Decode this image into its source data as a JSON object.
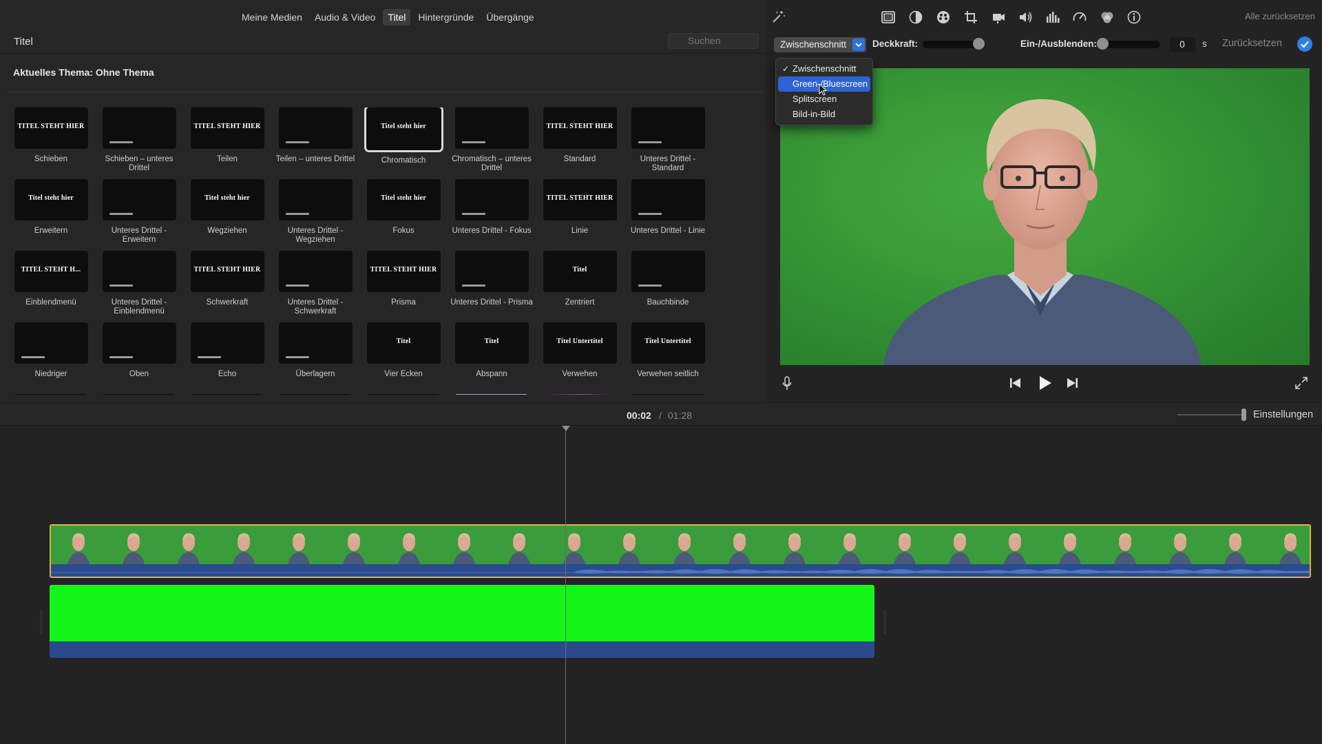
{
  "browser": {
    "tabs": [
      {
        "label": "Meine Medien",
        "active": false
      },
      {
        "label": "Audio & Video",
        "active": false
      },
      {
        "label": "Titel",
        "active": true
      },
      {
        "label": "Hintergründe",
        "active": false
      },
      {
        "label": "Übergänge",
        "active": false
      }
    ],
    "section_title": "Titel",
    "search_placeholder": "Suchen",
    "theme_label": "Aktuelles Thema: Ohne Thema",
    "titles": [
      {
        "label": "Schieben",
        "thumb": "TITEL STEHT HIER"
      },
      {
        "label": "Schieben – unteres Drittel",
        "thumb": ""
      },
      {
        "label": "Teilen",
        "thumb": "TITEL STEHT HIER"
      },
      {
        "label": "Teilen – unteres Drittel",
        "thumb": ""
      },
      {
        "label": "Chromatisch",
        "thumb": "Titel steht hier",
        "selected": true
      },
      {
        "label": "Chromatisch – unteres Drittel",
        "thumb": ""
      },
      {
        "label": "Standard",
        "thumb": "TITEL STEHT HIER"
      },
      {
        "label": "Unteres Drittel - Standard",
        "thumb": ""
      },
      {
        "label": "Erweitern",
        "thumb": "Titel steht hier"
      },
      {
        "label": "Unteres Drittel - Erweitern",
        "thumb": ""
      },
      {
        "label": "Wegziehen",
        "thumb": "Titel steht hier"
      },
      {
        "label": "Unteres Drittel - Wegziehen",
        "thumb": ""
      },
      {
        "label": "Fokus",
        "thumb": "Titel steht hier"
      },
      {
        "label": "Unteres Drittel - Fokus",
        "thumb": ""
      },
      {
        "label": "Linie",
        "thumb": "TITEL STEHT HIER"
      },
      {
        "label": "Unteres Drittel - Linie",
        "thumb": ""
      },
      {
        "label": "Einblendmenü",
        "thumb": "TITEL STEHT H..."
      },
      {
        "label": "Unteres Drittel - Einblendmenü",
        "thumb": ""
      },
      {
        "label": "Schwerkraft",
        "thumb": "TITEL STEHT HIER"
      },
      {
        "label": "Unteres Drittel - Schwerkraft",
        "thumb": ""
      },
      {
        "label": "Prisma",
        "thumb": "TITEL STEHT HIER"
      },
      {
        "label": "Unteres Drittel - Prisma",
        "thumb": ""
      },
      {
        "label": "Zentriert",
        "thumb": "Titel"
      },
      {
        "label": "Bauchbinde",
        "thumb": ""
      },
      {
        "label": "Niedriger",
        "thumb": ""
      },
      {
        "label": "Oben",
        "thumb": ""
      },
      {
        "label": "Echo",
        "thumb": ""
      },
      {
        "label": "Überlagern",
        "thumb": ""
      },
      {
        "label": "Vier Ecken",
        "thumb": "Titel"
      },
      {
        "label": "Abspann",
        "thumb": "Titel"
      },
      {
        "label": "Verwehen",
        "thumb": "Titel Untertitel"
      },
      {
        "label": "Verwehen seitlich",
        "thumb": "Titel Untertitel"
      }
    ]
  },
  "viewer": {
    "reset_all": "Alle zurücksetzen",
    "toolbar_icons": [
      "magic-wand-icon",
      "overlay-icon",
      "color-balance-icon",
      "color-correction-icon",
      "crop-icon",
      "stabilization-icon",
      "volume-icon",
      "equalizer-icon",
      "speed-icon",
      "filter-icon",
      "info-icon"
    ],
    "overlay_select": "Zwischenschnitt",
    "opacity_label": "Deckkraft:",
    "opacity_value": 0.9,
    "fade_label": "Ein-/Ausblenden:",
    "fade_value": "0",
    "fade_unit": "s",
    "reset_label": "Zurücksetzen",
    "menu": [
      {
        "label": "Zwischenschnitt",
        "checked": true,
        "highlighted": false
      },
      {
        "label": "Green-/Bluescreen",
        "checked": false,
        "highlighted": true
      },
      {
        "label": "Splitscreen",
        "checked": false,
        "highlighted": false
      },
      {
        "label": "Bild-in-Bild",
        "checked": false,
        "highlighted": false
      }
    ]
  },
  "timeline": {
    "current_time": "00:02",
    "separator": "/",
    "total_time": "01:28",
    "settings_label": "Einstellungen"
  },
  "colors": {
    "accent": "#2e63d6",
    "clip_border": "#d9b63a",
    "green_screen": "#14f51a",
    "audio_track": "#2a4b8e"
  }
}
